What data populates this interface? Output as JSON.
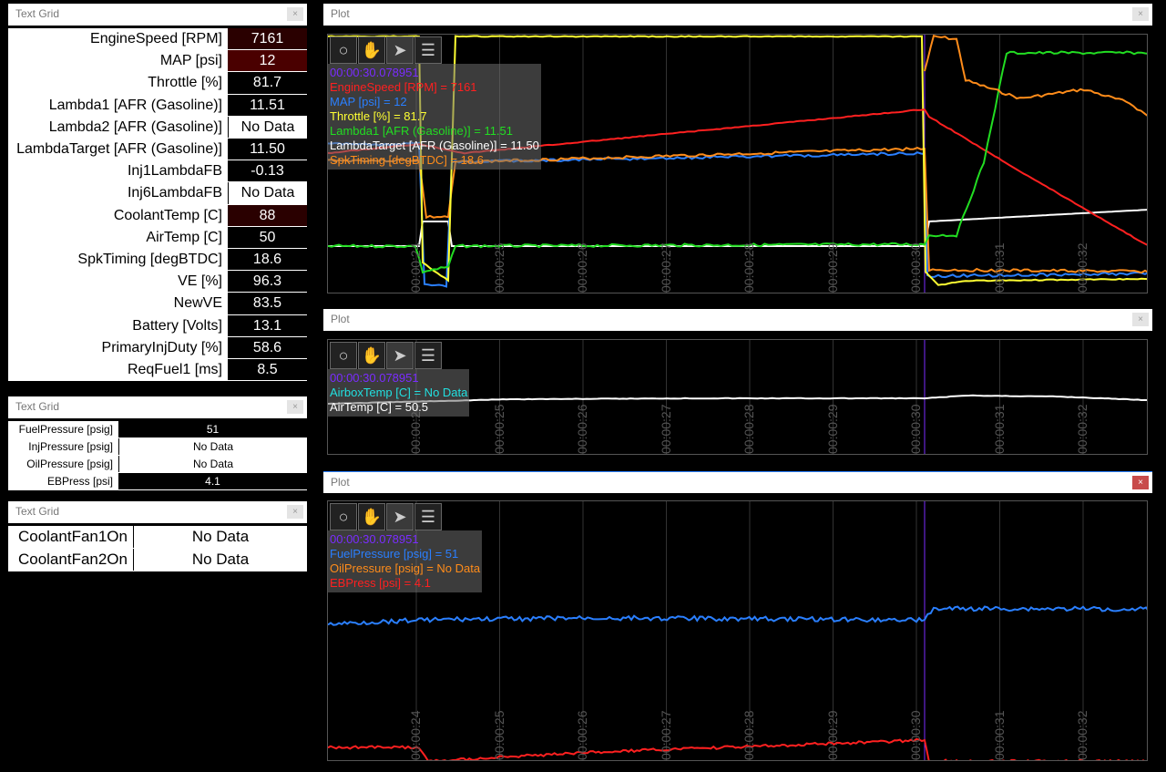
{
  "text_grid_1": {
    "title": "Text Grid",
    "close": "×",
    "rows": [
      {
        "label": "EngineSpeed [RPM]",
        "value": "7161",
        "style": "red-dark"
      },
      {
        "label": "MAP [psi]",
        "value": "12",
        "style": "red"
      },
      {
        "label": "Throttle [%]",
        "value": "81.7",
        "style": "dark"
      },
      {
        "label": "Lambda1 [AFR (Gasoline)]",
        "value": "11.51",
        "style": "dark"
      },
      {
        "label": "Lambda2 [AFR (Gasoline)]",
        "value": "No Data",
        "style": "white"
      },
      {
        "label": "LambdaTarget [AFR (Gasoline)]",
        "value": "11.50",
        "style": "dark"
      },
      {
        "label": "Inj1LambdaFB",
        "value": "-0.13",
        "style": "dark"
      },
      {
        "label": "Inj6LambdaFB",
        "value": "No Data",
        "style": "white"
      },
      {
        "label": "CoolantTemp [C]",
        "value": "88",
        "style": "red-dark"
      },
      {
        "label": "AirTemp [C]",
        "value": "50",
        "style": "dark"
      },
      {
        "label": "SpkTiming [degBTDC]",
        "value": "18.6",
        "style": "dark"
      },
      {
        "label": "VE [%]",
        "value": "96.3",
        "style": "dark"
      },
      {
        "label": "NewVE",
        "value": "83.5",
        "style": "dark"
      },
      {
        "label": "Battery [Volts]",
        "value": "13.1",
        "style": "dark"
      },
      {
        "label": "PrimaryInjDuty [%]",
        "value": "58.6",
        "style": "dark"
      },
      {
        "label": "ReqFuel1 [ms]",
        "value": "8.5",
        "style": "dark"
      }
    ]
  },
  "text_grid_2": {
    "title": "Text Grid",
    "close": "×",
    "rows": [
      {
        "label": "FuelPressure [psig]",
        "value": "51",
        "style": "dark"
      },
      {
        "label": "InjPressure [psig]",
        "value": "No Data",
        "style": "white"
      },
      {
        "label": "OilPressure [psig]",
        "value": "No Data",
        "style": "white"
      },
      {
        "label": "EBPress [psi]",
        "value": "4.1",
        "style": "dark"
      }
    ]
  },
  "text_grid_3": {
    "title": "Text Grid",
    "close": "×",
    "rows": [
      {
        "label": "CoolantFan1On",
        "value": "No Data"
      },
      {
        "label": "CoolantFan2On",
        "value": "No Data"
      }
    ]
  },
  "plots": {
    "time_ticks": [
      "00:00:24",
      "00:00:25",
      "00:00:26",
      "00:00:27",
      "00:00:28",
      "00:00:29",
      "00:00:30",
      "00:00:31",
      "00:00:32"
    ],
    "plot1": {
      "title": "Plot",
      "close": "×",
      "legend": [
        {
          "text": "00:00:30.078951",
          "color": "#7a2cff"
        },
        {
          "text": "EngineSpeed [RPM] = 7161",
          "color": "#ff2020"
        },
        {
          "text": "MAP [psi] = 12",
          "color": "#2a7fff"
        },
        {
          "text": "Throttle [%] = 81.7",
          "color": "#ffff33"
        },
        {
          "text": "Lambda1 [AFR (Gasoline)] = 11.51",
          "color": "#22dd22"
        },
        {
          "text": "LambdaTarget [AFR (Gasoline)] = 11.50",
          "color": "#ffffff"
        },
        {
          "text": "SpkTiming [degBTDC] = 18.6",
          "color": "#ff8c1a"
        }
      ]
    },
    "plot2": {
      "title": "Plot",
      "close": "×",
      "legend": [
        {
          "text": "00:00:30.078951",
          "color": "#7a2cff"
        },
        {
          "text": "AirboxTemp [C] = No Data",
          "color": "#22e0e0"
        },
        {
          "text": "AirTemp [C] = 50.5",
          "color": "#ffffff"
        }
      ]
    },
    "plot3": {
      "title": "Plot",
      "close": "×",
      "legend": [
        {
          "text": "00:00:30.078951",
          "color": "#7a2cff"
        },
        {
          "text": "FuelPressure [psig] = 51",
          "color": "#2a7fff"
        },
        {
          "text": "OilPressure [psig] = No Data",
          "color": "#ff8c1a"
        },
        {
          "text": "EBPress [psi] = 4.1",
          "color": "#ff2020"
        }
      ]
    }
  }
}
